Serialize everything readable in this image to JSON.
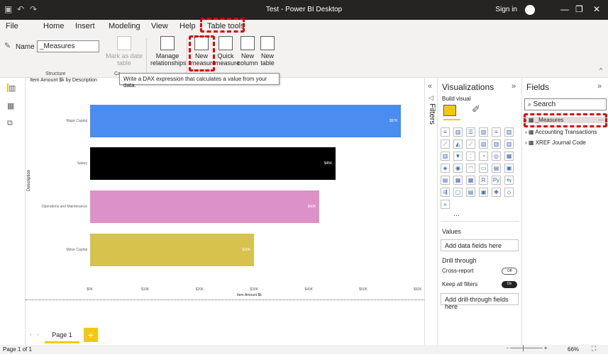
{
  "window": {
    "title": "Test - Power BI Desktop",
    "signin": "Sign in"
  },
  "menu": {
    "items": [
      "File",
      "Home",
      "Insert",
      "Modeling",
      "View",
      "Help",
      "Table tools"
    ]
  },
  "ribbon": {
    "name_label": "Name",
    "name_value": "_Measures",
    "structure_label": "Structure",
    "calc_label": "Ca",
    "mark_as_date": "Mark as date table",
    "manage_rel": "Manage relationships",
    "new_measure": "New measure",
    "quick_measure": "Quick measure",
    "new_column": "New column",
    "new_table": "New table"
  },
  "tooltip": "Write a DAX expression that calculates a value from your data.",
  "chart_data": {
    "type": "bar",
    "orientation": "horizontal",
    "title": "Item Amount $k by Description",
    "xlabel": "Item Amount $k",
    "ylabel": "Description",
    "categories": [
      "Major Capital",
      "Salary",
      "Operations and Maintenance",
      "Minor Capital"
    ],
    "values": [
      57,
      45,
      42,
      30
    ],
    "data_labels": [
      "$57K",
      "$45K",
      "$42K",
      "$30K"
    ],
    "colors": [
      "#4a8cf0",
      "#000000",
      "#dc91c8",
      "#d6c24d"
    ],
    "xlim": [
      0,
      60
    ],
    "xticks": [
      "$0K",
      "$10K",
      "$20K",
      "$30K",
      "$40K",
      "$50K",
      "$60K"
    ],
    "grid": false
  },
  "pages": {
    "tab": "Page 1",
    "add": "+",
    "status": "Page 1 of 1",
    "zoom": "66%"
  },
  "filters": {
    "label": "Filters"
  },
  "viz": {
    "title": "Visualizations",
    "build": "Build visual",
    "more": "···",
    "values": "Values",
    "values_well": "Add data fields here",
    "drill": "Drill through",
    "cross_report": "Cross-report",
    "cross_state": "Off",
    "keep_filters": "Keep all filters",
    "keep_state": "On",
    "drill_well": "Add drill-through fields here"
  },
  "fields": {
    "title": "Fields",
    "search": "Search",
    "items": [
      "_Measures",
      "Accounting Transactions",
      "XREF Journal Code"
    ],
    "row_more": "···"
  },
  "accent": "#f2c811",
  "highlight": "#d90000"
}
